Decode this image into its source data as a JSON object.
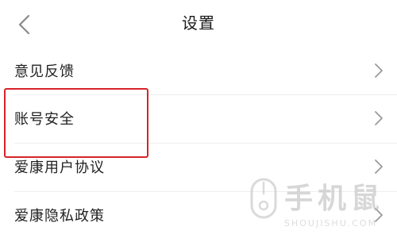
{
  "header": {
    "title": "设置",
    "back_icon": "chevron-left-icon"
  },
  "settings": {
    "items": [
      {
        "label": "意见反馈",
        "icon": "chevron-right-icon"
      },
      {
        "label": "账号安全",
        "icon": "chevron-right-icon",
        "highlighted": true
      },
      {
        "label": "爱康用户协议",
        "icon": "chevron-right-icon"
      },
      {
        "label": "爱康隐私政策",
        "icon": "chevron-right-icon"
      }
    ]
  },
  "annotation": {
    "highlight_color": "#d8232a"
  },
  "watermark": {
    "text_cn": "手机鼠",
    "text_en": "SHOUJISHU.COM"
  },
  "colors": {
    "text": "#222222",
    "chevron": "#9a9a9a",
    "divider": "#eeeeee",
    "background": "#ffffff"
  }
}
